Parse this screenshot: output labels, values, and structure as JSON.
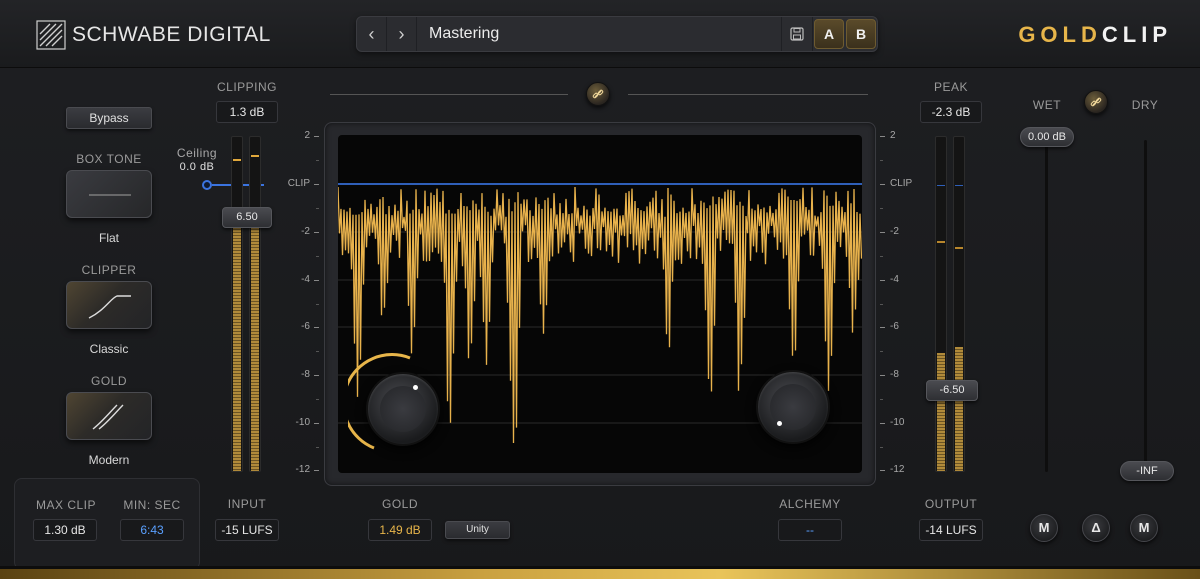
{
  "header": {
    "brand": "SCHWABE DIGITAL",
    "preset": "Mastering",
    "a_label": "A",
    "b_label": "B",
    "product_gold": "GOLD",
    "product_clip": "CLIP"
  },
  "left": {
    "bypass": "Bypass",
    "box_tone_label": "BOX TONE",
    "box_tone_value": "Flat",
    "clipper_label": "CLIPPER",
    "clipper_value": "Classic",
    "gold_label": "GOLD",
    "gold_value": "Modern",
    "max_clip_label": "MAX CLIP",
    "max_clip_value": "1.30 dB",
    "min_sec_label": "MIN: SEC",
    "min_sec_value": "6:43"
  },
  "input": {
    "clipping_label": "CLIPPING",
    "clipping_value": "1.3 dB",
    "ceiling_label": "Ceiling",
    "ceiling_value": "0.0 dB",
    "fader_value": "6.50",
    "input_label": "INPUT",
    "input_value": "-15 LUFS"
  },
  "center": {
    "scale_labels": [
      "2",
      "CLIP",
      "-2",
      "-4",
      "-6",
      "-8",
      "-10",
      "-12"
    ],
    "gold_label": "GOLD",
    "gold_value": "1.49 dB",
    "unity_label": "Unity",
    "alchemy_label": "ALCHEMY",
    "alchemy_value": "--"
  },
  "output": {
    "peak_label": "PEAK",
    "peak_value": "-2.3 dB",
    "fader_value": "-6.50",
    "output_label": "OUTPUT",
    "output_value": "-14 LUFS"
  },
  "mix": {
    "wet_label": "WET",
    "dry_label": "DRY",
    "wet_value": "0.00 dB",
    "dry_value": "-INF",
    "m_left": "M",
    "delta": "Δ",
    "m_right": "M"
  },
  "colors": {
    "accent_gold": "#e7b54a",
    "clip_line": "#2f5fb8",
    "waveform": "#e8b24c"
  },
  "meters": {
    "input_level_db": -6.5,
    "output_level_db": -6.5
  }
}
